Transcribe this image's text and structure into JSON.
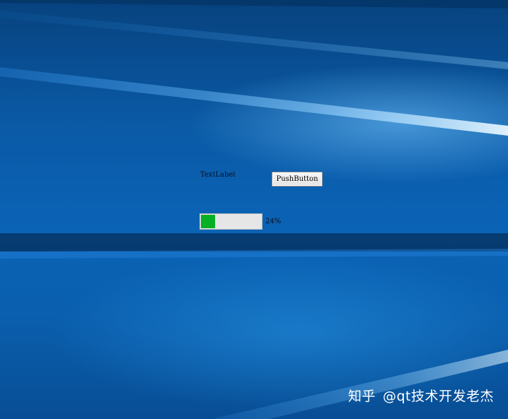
{
  "window": {
    "label_text": "TextLabel",
    "button_label": "PushButton",
    "progress": {
      "value": 24,
      "max": 100,
      "text": "24%",
      "fill_color": "#06b025"
    }
  },
  "watermark": {
    "brand": "知乎",
    "author": "@qt技术开发老杰"
  },
  "colors": {
    "desktop_blue": "#0b63b6"
  }
}
